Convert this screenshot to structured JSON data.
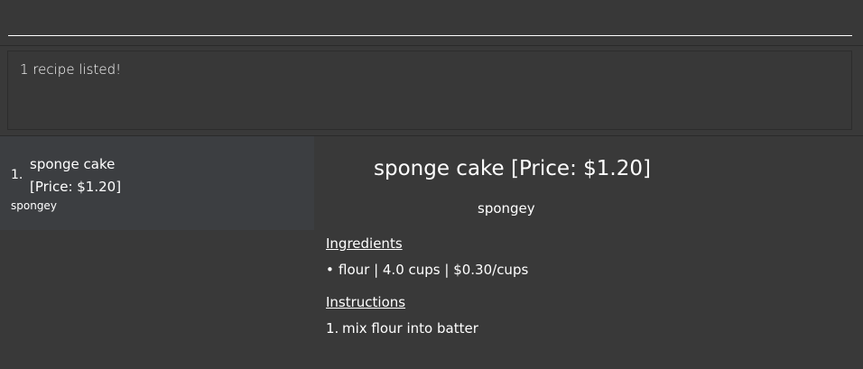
{
  "command_box": {
    "value": "",
    "placeholder": ""
  },
  "result_display": {
    "text": "1 recipe listed!"
  },
  "recipe_list": {
    "items": [
      {
        "index": "1.",
        "name": "sponge cake",
        "price": "[Price: $1.20]",
        "tag": "spongey"
      }
    ]
  },
  "recipe_detail": {
    "title": "sponge cake [Price: $1.20]",
    "description": "spongey",
    "ingredients_heading": "Ingredients",
    "ingredients": [
      {
        "bullet": "•",
        "text": "flour | 4.0 cups | $0.30/cups"
      }
    ],
    "instructions_heading": "Instructions",
    "instructions": [
      {
        "number": "1.",
        "text": "mix flour into batter"
      }
    ]
  },
  "colors": {
    "background": "#393939",
    "card_background": "#3c3e41",
    "text": "#ffffff",
    "border": "#2a2a2a"
  }
}
